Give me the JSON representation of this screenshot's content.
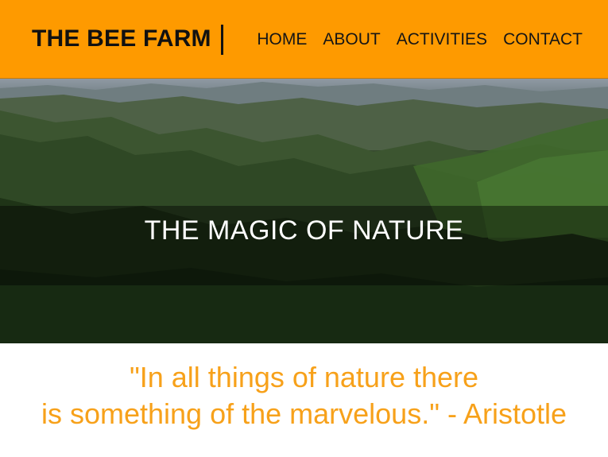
{
  "header": {
    "brand": "THE BEE FARM",
    "nav": [
      "HOME",
      "ABOUT",
      "ACTIVITIES",
      "CONTACT"
    ]
  },
  "hero": {
    "title": "THE MAGIC OF NATURE"
  },
  "quote": {
    "line1": "\"In all things of nature there",
    "line2": "is something of the marvelous.\" - Aristotle"
  },
  "colors": {
    "header_bg": "#fe9a00",
    "quote_text": "#f7a11a",
    "forest_dark": "#1c2f15"
  }
}
